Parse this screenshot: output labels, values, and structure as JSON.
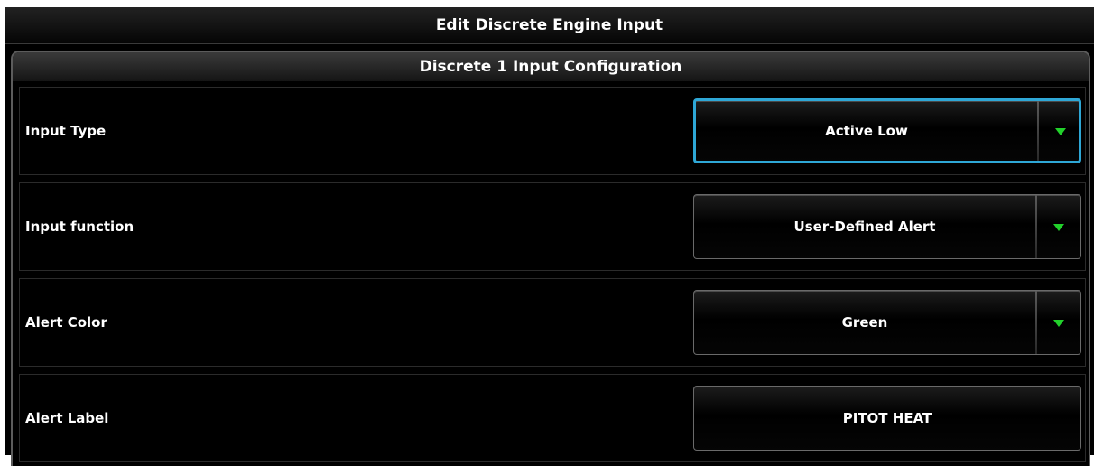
{
  "window": {
    "title": "Edit Discrete Engine Input"
  },
  "panel": {
    "header": "Discrete 1 Input Configuration",
    "rows": [
      {
        "label": "Input Type",
        "value": "Active Low",
        "control": "dropdown",
        "selected": true,
        "icon": "chevron-down-icon"
      },
      {
        "label": "Input function",
        "value": "User-Defined Alert",
        "control": "dropdown",
        "selected": false,
        "icon": "chevron-down-icon"
      },
      {
        "label": "Alert Color",
        "value": "Green",
        "control": "dropdown",
        "selected": false,
        "icon": "chevron-down-icon"
      },
      {
        "label": "Alert Label",
        "value": "PITOT HEAT",
        "control": "button",
        "selected": false
      }
    ]
  },
  "colors": {
    "background": "#000000",
    "text": "#ffffff",
    "selection_border": "#2ea7d6",
    "dropdown_arrow": "#22d12b"
  }
}
